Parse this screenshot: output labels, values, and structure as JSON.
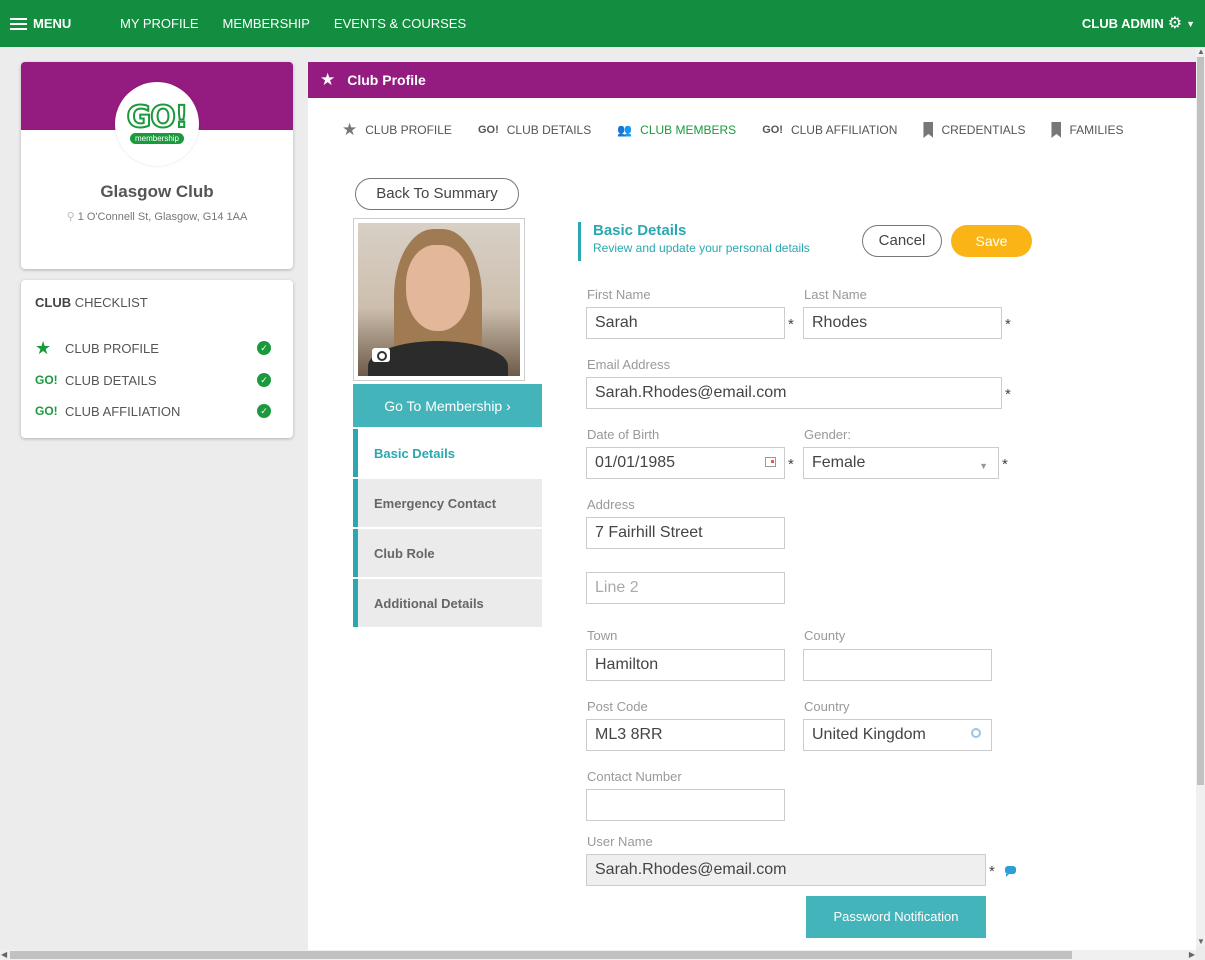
{
  "topbar": {
    "menu_label": "MENU",
    "nav": [
      "MY PROFILE",
      "MEMBERSHIP",
      "EVENTS & COURSES"
    ],
    "admin_label": "CLUB ADMIN"
  },
  "club": {
    "logo_text": "GO!",
    "logo_sub": "membership",
    "name": "Glasgow Club",
    "address": "1 O'Connell St, Glasgow, G14 1AA"
  },
  "checklist": {
    "title_bold": "CLUB",
    "title_rest": " CHECKLIST",
    "items": [
      {
        "icon": "star",
        "label": "CLUB PROFILE",
        "done": true
      },
      {
        "icon": "go",
        "label": "CLUB DETAILS",
        "done": true
      },
      {
        "icon": "go",
        "label": "CLUB AFFILIATION",
        "done": true
      }
    ]
  },
  "panel": {
    "title": "Club Profile",
    "tabs": [
      {
        "icon": "star",
        "label": "CLUB PROFILE"
      },
      {
        "icon": "go",
        "label": "CLUB DETAILS"
      },
      {
        "icon": "members",
        "label": "CLUB MEMBERS",
        "active": true
      },
      {
        "icon": "go",
        "label": "CLUB AFFILIATION"
      },
      {
        "icon": "bookmark",
        "label": "CREDENTIALS"
      },
      {
        "icon": "bookmark",
        "label": "FAMILIES"
      }
    ],
    "go_icon_text": "GO!",
    "back_label": "Back To Summary",
    "goto_label": "Go To Membership ›",
    "side_nav": [
      "Basic Details",
      "Emergency Contact",
      "Club Role",
      "Additional Details"
    ]
  },
  "form": {
    "section_title": "Basic Details",
    "section_subtitle": "Review and update your personal details",
    "cancel_label": "Cancel",
    "save_label": "Save",
    "first_name_label": "First Name",
    "first_name": "Sarah",
    "last_name_label": "Last Name",
    "last_name": "Rhodes",
    "email_label": "Email Address",
    "email": "Sarah.Rhodes@email.com",
    "dob_label": "Date of Birth",
    "dob": "01/01/1985",
    "gender_label": "Gender:",
    "gender": "Female",
    "address_label": "Address",
    "address1": "7 Fairhill Street",
    "address2_placeholder": "Line 2",
    "town_label": "Town",
    "town": "Hamilton",
    "county_label": "County",
    "county": "",
    "postcode_label": "Post Code",
    "postcode": "ML3 8RR",
    "country_label": "Country",
    "country": "United Kingdom",
    "contact_label": "Contact Number",
    "contact": "",
    "username_label": "User Name",
    "username": "Sarah.Rhodes@email.com",
    "password_btn": "Password Notification",
    "required_mark": "*"
  },
  "colors": {
    "brand_green": "#138d3f",
    "brand_purple": "#941b80",
    "teal": "#43b4ba",
    "save_yellow": "#fbb416"
  }
}
